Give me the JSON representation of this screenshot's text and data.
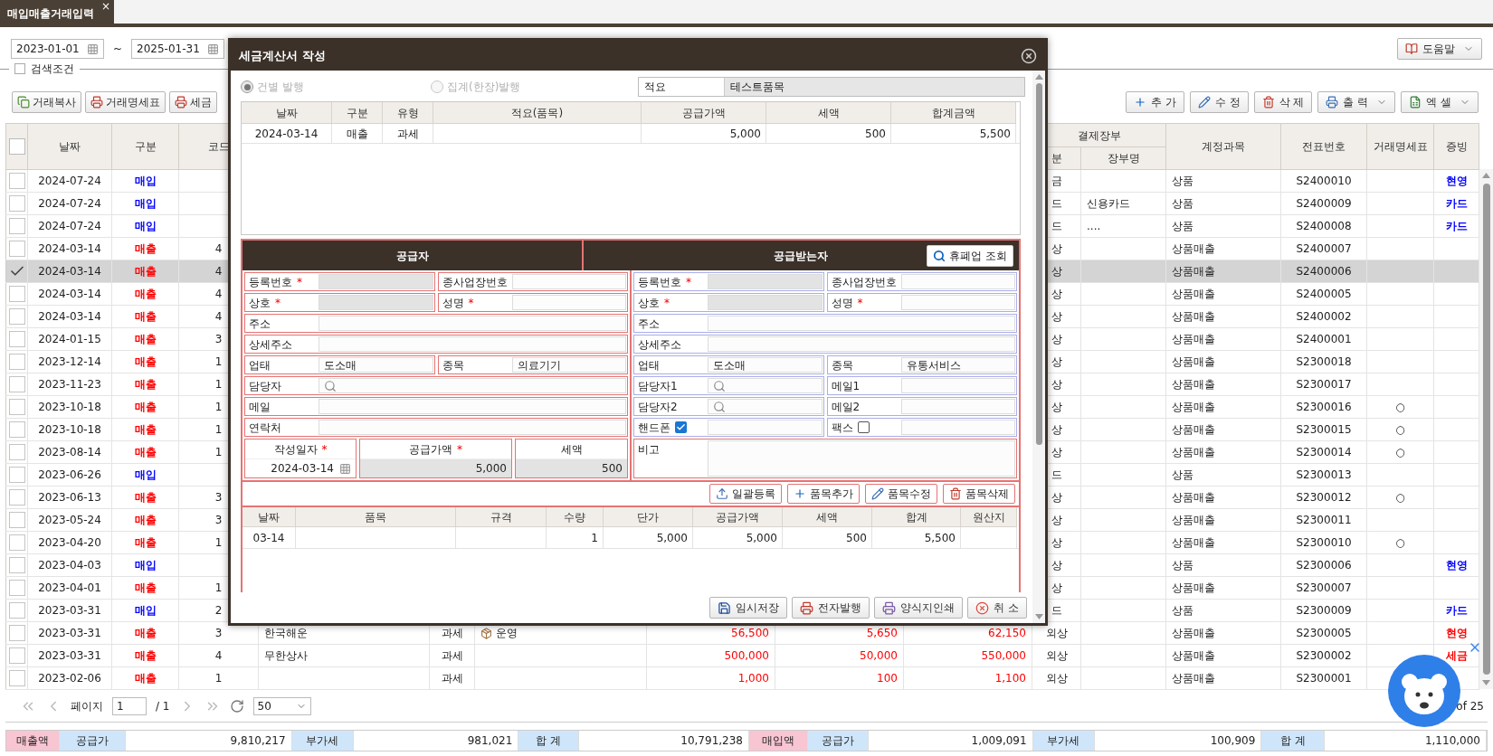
{
  "tab": {
    "label": "매입매출거래입력",
    "close": "×"
  },
  "filter": {
    "date_from": "2023-01-01",
    "separator": "~",
    "date_to": "2025-01-31",
    "search_toggle": {
      "label": "검색조건",
      "checked": false
    }
  },
  "help_button": {
    "label": "도움말"
  },
  "toolbar_left": [
    {
      "label": "거래복사"
    },
    {
      "label": "거래명세표"
    },
    {
      "label": "세금"
    }
  ],
  "toolbar_right": [
    {
      "label": "추 가",
      "menu": false
    },
    {
      "label": "수 정",
      "menu": false
    },
    {
      "label": "삭 제",
      "menu": false
    },
    {
      "label": "출 력",
      "menu": true
    },
    {
      "label": "엑 셀",
      "menu": true
    }
  ],
  "table": {
    "all_checked": false,
    "columns": [
      "날짜",
      "구분",
      "코드"
    ],
    "payment_group": {
      "label": "결제장부",
      "columns": [
        "분",
        "장부명"
      ]
    },
    "columns_right": [
      "계정과목",
      "전표번호",
      "거래명세표",
      "증빙"
    ],
    "rows": [
      {
        "checked": false,
        "selected": false,
        "date": "2024-07-24",
        "type": {
          "text": "매입",
          "color": "#0000ff"
        },
        "pay": "금",
        "account": "상품",
        "slip": "S2400010",
        "evidence": {
          "text": "현영",
          "color": "#0000ff"
        }
      },
      {
        "checked": false,
        "selected": false,
        "date": "2024-07-24",
        "type": {
          "text": "매입",
          "color": "#0000ff"
        },
        "pay": "드",
        "book": "신용카드",
        "account": "상품",
        "slip": "S2400009",
        "evidence": {
          "text": "카드",
          "color": "#0000ff"
        }
      },
      {
        "checked": false,
        "selected": false,
        "date": "2024-07-24",
        "type": {
          "text": "매입",
          "color": "#0000ff"
        },
        "pay": "드",
        "book": "....",
        "account": "상품",
        "slip": "S2400008",
        "evidence": {
          "text": "카드",
          "color": "#0000ff"
        }
      },
      {
        "checked": false,
        "selected": false,
        "date": "2024-03-14",
        "type": {
          "text": "매출",
          "color": "#ff0000"
        },
        "code": "4",
        "pay": "상",
        "account": "상품매출",
        "slip": "S2400007"
      },
      {
        "checked": true,
        "selected": true,
        "date": "2024-03-14",
        "type": {
          "text": "매출",
          "color": "#ff0000"
        },
        "code": "4",
        "pay": "상",
        "account": "상품매출",
        "slip": "S2400006"
      },
      {
        "checked": false,
        "selected": false,
        "date": "2024-03-14",
        "type": {
          "text": "매출",
          "color": "#ff0000"
        },
        "code": "4",
        "pay": "상",
        "account": "상품매출",
        "slip": "S2400005"
      },
      {
        "checked": false,
        "selected": false,
        "date": "2024-03-14",
        "type": {
          "text": "매출",
          "color": "#ff0000"
        },
        "code": "4",
        "pay": "상",
        "account": "상품매출",
        "slip": "S2400002"
      },
      {
        "checked": false,
        "selected": false,
        "date": "2024-01-15",
        "type": {
          "text": "매출",
          "color": "#ff0000"
        },
        "code": "3",
        "pay": "상",
        "account": "상품매출",
        "slip": "S2400001"
      },
      {
        "checked": false,
        "selected": false,
        "date": "2023-12-14",
        "type": {
          "text": "매출",
          "color": "#ff0000"
        },
        "code": "1",
        "pay": "상",
        "account": "상품매출",
        "slip": "S2300018"
      },
      {
        "checked": false,
        "selected": false,
        "date": "2023-11-23",
        "type": {
          "text": "매출",
          "color": "#ff0000"
        },
        "code": "1",
        "pay": "상",
        "account": "상품매출",
        "slip": "S2300017"
      },
      {
        "checked": false,
        "selected": false,
        "date": "2023-10-18",
        "type": {
          "text": "매출",
          "color": "#ff0000"
        },
        "code": "1",
        "pay": "상",
        "account": "상품매출",
        "slip": "S2300016",
        "statement": "○"
      },
      {
        "checked": false,
        "selected": false,
        "date": "2023-10-18",
        "type": {
          "text": "매출",
          "color": "#ff0000"
        },
        "code": "1",
        "pay": "상",
        "account": "상품매출",
        "slip": "S2300015",
        "statement": "○"
      },
      {
        "checked": false,
        "selected": false,
        "date": "2023-08-14",
        "type": {
          "text": "매출",
          "color": "#ff0000"
        },
        "code": "1",
        "pay": "상",
        "account": "상품매출",
        "slip": "S2300014",
        "statement": "○"
      },
      {
        "checked": false,
        "selected": false,
        "date": "2023-06-26",
        "type": {
          "text": "매입",
          "color": "#0000ff"
        },
        "pay": "드",
        "account": "상품",
        "slip": "S2300013"
      },
      {
        "checked": false,
        "selected": false,
        "date": "2023-06-13",
        "type": {
          "text": "매출",
          "color": "#ff0000"
        },
        "code": "3",
        "pay": "상",
        "account": "상품매출",
        "slip": "S2300012",
        "statement": "○"
      },
      {
        "checked": false,
        "selected": false,
        "date": "2023-05-24",
        "type": {
          "text": "매출",
          "color": "#ff0000"
        },
        "code": "3",
        "pay": "상",
        "account": "상품매출",
        "slip": "S2300011"
      },
      {
        "checked": false,
        "selected": false,
        "date": "2023-04-20",
        "type": {
          "text": "매출",
          "color": "#ff0000"
        },
        "code": "1",
        "pay": "상",
        "account": "상품매출",
        "slip": "S2300010",
        "statement": "○"
      },
      {
        "checked": false,
        "selected": false,
        "date": "2023-04-03",
        "type": {
          "text": "매입",
          "color": "#0000ff"
        },
        "pay": "상",
        "account": "상품",
        "slip": "S2300006",
        "evidence": {
          "text": "현영",
          "color": "#0000ff"
        }
      },
      {
        "checked": false,
        "selected": false,
        "date": "2023-04-01",
        "type": {
          "text": "매출",
          "color": "#ff0000"
        },
        "code": "1",
        "pay": "상",
        "account": "상품매출",
        "slip": "S2300007"
      },
      {
        "checked": false,
        "selected": false,
        "date": "2023-03-31",
        "type": {
          "text": "매입",
          "color": "#0000ff"
        },
        "code": "2",
        "pay": "드",
        "account": "상품",
        "slip": "S2300009",
        "evidence": {
          "text": "카드",
          "color": "#0000ff"
        }
      },
      {
        "checked": false,
        "selected": false,
        "date": "2023-03-31",
        "type": {
          "text": "매출",
          "color": "#ff0000"
        },
        "code": "3",
        "partner": "한국해운",
        "tax_type": "과세",
        "item": "운영",
        "supply": "56,500",
        "tax": "5,650",
        "total": "62,150",
        "pay": "외상",
        "account": "상품매출",
        "slip": "S2300005",
        "evidence": {
          "text": "현영",
          "color": "#ff0000"
        }
      },
      {
        "checked": false,
        "selected": false,
        "date": "2023-03-31",
        "type": {
          "text": "매출",
          "color": "#ff0000"
        },
        "code": "4",
        "partner": "무한상사",
        "tax_type": "과세",
        "supply": "500,000",
        "tax": "50,000",
        "total": "550,000",
        "pay": "외상",
        "account": "상품매출",
        "slip": "S2300002",
        "evidence": {
          "text": "세금",
          "color": "#ff0000"
        }
      },
      {
        "checked": false,
        "selected": false,
        "date": "2023-02-06",
        "type": {
          "text": "매출",
          "color": "#ff0000"
        },
        "code": "1",
        "tax_type": "과세",
        "supply": "1,000",
        "tax": "100",
        "total": "1,100",
        "pay": "외상",
        "account": "상품매출",
        "slip": "S2300001"
      }
    ]
  },
  "pager": {
    "label": "페이지",
    "page": "1",
    "of_pages": "/ 1",
    "page_size": "50",
    "count": "of 25"
  },
  "summary_bar": [
    {
      "text": "매출액",
      "kind": "section"
    },
    {
      "text": "공급가",
      "kind": "label"
    },
    {
      "text": "9,810,217",
      "kind": "value"
    },
    {
      "text": "부가세",
      "kind": "label"
    },
    {
      "text": "981,021",
      "kind": "value"
    },
    {
      "text": "합 계",
      "kind": "label"
    },
    {
      "text": "10,791,238",
      "kind": "value"
    },
    {
      "text": "매입액",
      "kind": "section"
    },
    {
      "text": "공급가",
      "kind": "label"
    },
    {
      "text": "1,009,091",
      "kind": "value"
    },
    {
      "text": "부가세",
      "kind": "label"
    },
    {
      "text": "100,909",
      "kind": "value"
    },
    {
      "text": "합 계",
      "kind": "label"
    },
    {
      "text": "1,110,000",
      "kind": "value"
    }
  ],
  "modal": {
    "title": "세금계산서 작성",
    "issue_options": [
      {
        "label": "건별 발행",
        "selected": true,
        "disabled": true
      },
      {
        "label": "집계(한장)발행",
        "selected": false,
        "disabled": true
      }
    ],
    "summary_field": {
      "label": "적요",
      "value": "테스트품목"
    },
    "invoice_table": {
      "columns": [
        "날짜",
        "구분",
        "유형",
        "적요(품목)",
        "공급가액",
        "세액",
        "합계금액"
      ],
      "rows": [
        {
          "date": "2024-03-14",
          "type": "매출",
          "tax_type": "과세",
          "supply": "5,000",
          "tax": "500",
          "total": "5,500"
        }
      ]
    },
    "supplier": {
      "title": "공급자",
      "rows": [
        [
          {
            "label": "등록번호",
            "required_mark": "*",
            "kind": "text",
            "disabled": true,
            "flagged": true
          },
          {
            "label": "종사업장번호",
            "kind": "text",
            "disabled": false,
            "flagged": true
          }
        ],
        [
          {
            "label": "상호",
            "required_mark": "*",
            "kind": "text",
            "disabled": true,
            "flagged": true
          },
          {
            "label": "성명",
            "required_mark": "*",
            "kind": "text",
            "disabled": false,
            "flagged": true
          }
        ],
        [
          {
            "label": "주소",
            "kind": "text",
            "disabled": false,
            "flagged": true
          }
        ],
        [
          {
            "label": "상세주소",
            "kind": "text",
            "disabled": false,
            "flagged": true
          }
        ],
        [
          {
            "label": "업태",
            "value": "도소매",
            "kind": "text",
            "disabled": false,
            "flagged": true
          },
          {
            "label": "종목",
            "value": "의료기기",
            "kind": "text",
            "disabled": false,
            "flagged": true
          }
        ],
        [
          {
            "label": "담당자",
            "kind": "search",
            "disabled": false,
            "flagged": true
          }
        ],
        [
          {
            "label": "메일",
            "kind": "text",
            "disabled": false,
            "flagged": true
          }
        ],
        [
          {
            "label": "연락처",
            "kind": "text",
            "disabled": false,
            "flagged": true
          }
        ]
      ],
      "totals": [
        {
          "label": "작성일자",
          "required_mark": "*",
          "value": "2024-03-14",
          "kind": "date",
          "disabled": false
        },
        {
          "label": "공급가액",
          "required_mark": "*",
          "value": "5,000",
          "kind": "amount",
          "disabled": true
        },
        {
          "label": "세액",
          "value": "500",
          "kind": "amount",
          "disabled": true
        }
      ]
    },
    "buyer": {
      "title": "공급받는자",
      "lookup_button": "휴폐업 조회",
      "rows": [
        [
          {
            "label": "등록번호",
            "required_mark": "*",
            "kind": "text",
            "disabled": true,
            "flagged": false
          },
          {
            "label": "종사업장번호",
            "kind": "text",
            "disabled": false,
            "flagged": false
          }
        ],
        [
          {
            "label": "상호",
            "required_mark": "*",
            "kind": "text",
            "disabled": true,
            "flagged": false
          },
          {
            "label": "성명",
            "required_mark": "*",
            "kind": "text",
            "disabled": false,
            "flagged": false
          }
        ],
        [
          {
            "label": "주소",
            "kind": "text",
            "disabled": false,
            "flagged": false
          }
        ],
        [
          {
            "label": "상세주소",
            "kind": "text",
            "disabled": false,
            "flagged": false
          }
        ],
        [
          {
            "label": "업태",
            "value": "도소매",
            "kind": "text",
            "disabled": false,
            "flagged": false
          },
          {
            "label": "종목",
            "value": "유통서비스",
            "kind": "text",
            "disabled": false,
            "flagged": false
          }
        ],
        [
          {
            "label": "담당자1",
            "kind": "search",
            "disabled": false,
            "flagged": false
          },
          {
            "label": "메일1",
            "kind": "text",
            "disabled": false,
            "flagged": false
          }
        ],
        [
          {
            "label": "담당자2",
            "kind": "search",
            "disabled": false,
            "flagged": false
          },
          {
            "label": "메일2",
            "kind": "text",
            "disabled": false,
            "flagged": false
          }
        ],
        [
          {
            "label": "핸드폰",
            "kind": "check",
            "checked": true,
            "disabled": false,
            "flagged": false
          },
          {
            "label": "팩스",
            "kind": "check",
            "checked": false,
            "disabled": false,
            "flagged": false
          }
        ],
        [
          {
            "label": "비고",
            "kind": "memo",
            "disabled": false,
            "flagged": true
          }
        ]
      ]
    },
    "item_buttons": [
      {
        "label": "일괄등록"
      },
      {
        "label": "품목추가"
      },
      {
        "label": "품목수정"
      },
      {
        "label": "품목삭제"
      }
    ],
    "items_table": {
      "columns": [
        "날짜",
        "품목",
        "규격",
        "수량",
        "단가",
        "공급가액",
        "세액",
        "합계",
        "원산지"
      ],
      "rows": [
        {
          "date": "03-14",
          "qty": "1",
          "unit_price": "5,000",
          "supply": "5,000",
          "tax": "500",
          "total": "5,500"
        }
      ]
    },
    "footer_buttons": [
      {
        "label": "임시저장"
      },
      {
        "label": "전자발행"
      },
      {
        "label": "양식지인쇄"
      },
      {
        "label": "취 소"
      }
    ]
  }
}
